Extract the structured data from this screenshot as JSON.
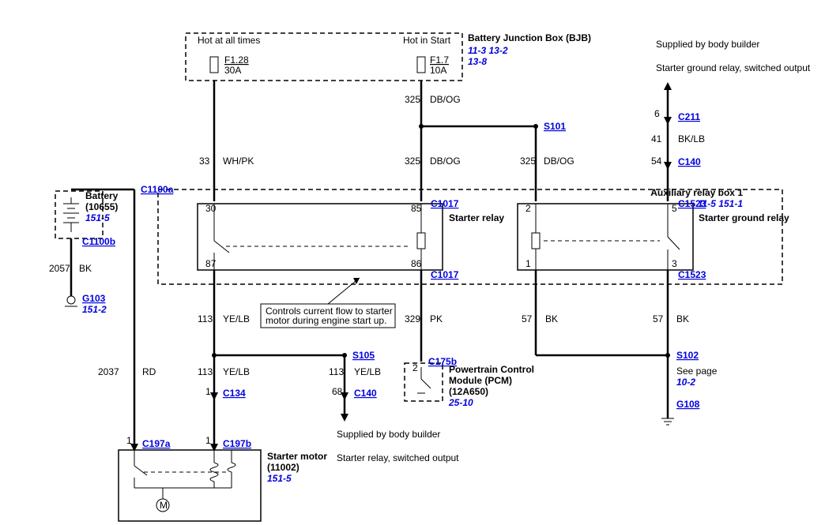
{
  "boxes": {
    "bjb": {
      "title": "Battery Junction Box (BJB)",
      "refs": [
        "11-3",
        "13-2",
        "13-8"
      ],
      "f1": {
        "name": "F1.28",
        "amps": "30A",
        "note": "Hot at all times"
      },
      "f2": {
        "name": "F1.7",
        "amps": "10A",
        "note": "Hot in Start"
      }
    },
    "arb": {
      "title": "Auxiliary relay box 1",
      "refs": [
        "11-5",
        "151-1"
      ],
      "relay1": "Starter relay",
      "relay2": "Starter ground relay",
      "pins": {
        "p30": "30",
        "p85": "85",
        "p87": "87",
        "p86": "86",
        "p2": "2",
        "p5": "5",
        "p1": "1",
        "p3": "3"
      }
    },
    "starter": {
      "title": "Starter motor (11002)",
      "ref": "151-5"
    },
    "battery": {
      "title": "Battery (10655)",
      "ref": "151-5"
    },
    "pcm": {
      "title": "Powertrain Control Module (PCM) (12A650)",
      "ref": "25-10"
    }
  },
  "notes": {
    "controls": "Controls current flow to starter motor during engine start up.",
    "supplied1": "Supplied by body builder",
    "starter_sw": "Starter relay, switched output",
    "supplied2": "Supplied by body builder",
    "starter_gnd": "Starter ground relay, switched output",
    "seepage": "See page",
    "seepage_ref": "10-2"
  },
  "wires": {
    "w33": {
      "num": "33",
      "color": "WH/PK"
    },
    "w325a": {
      "num": "325",
      "color": "DB/OG"
    },
    "w325b": {
      "num": "325",
      "color": "DB/OG"
    },
    "w325c": {
      "num": "325",
      "color": "DB/OG"
    },
    "w113a": {
      "num": "113",
      "color": "YE/LB"
    },
    "w113b": {
      "num": "113",
      "color": "YE/LB"
    },
    "w113c": {
      "num": "113",
      "color": "YE/LB"
    },
    "w329": {
      "num": "329",
      "color": "PK"
    },
    "w57a": {
      "num": "57",
      "color": "BK"
    },
    "w57b": {
      "num": "57",
      "color": "BK"
    },
    "w2057": {
      "num": "2057",
      "color": "BK"
    },
    "w2037": {
      "num": "2037",
      "color": "RD"
    },
    "w6": {
      "num": "6"
    },
    "w41": {
      "num": "41",
      "color": "BK/LB"
    },
    "w54": {
      "num": "54"
    },
    "w68": {
      "num": "68"
    },
    "w1a": {
      "num": "1"
    },
    "w1b": {
      "num": "1"
    },
    "w2": {
      "num": "2"
    }
  },
  "conn": {
    "C1100a": "C1100a",
    "C1100b": "C1100b",
    "G103": "G103",
    "G103r": "151-2",
    "C197a": "C197a",
    "C197b": "C197b",
    "C1017": "C1017",
    "C1523": "C1523",
    "C134": "C134",
    "C140": "C140",
    "S105": "S105",
    "S101": "S101",
    "S102": "S102",
    "G108": "G108",
    "C175b": "C175b",
    "C211": "C211"
  }
}
